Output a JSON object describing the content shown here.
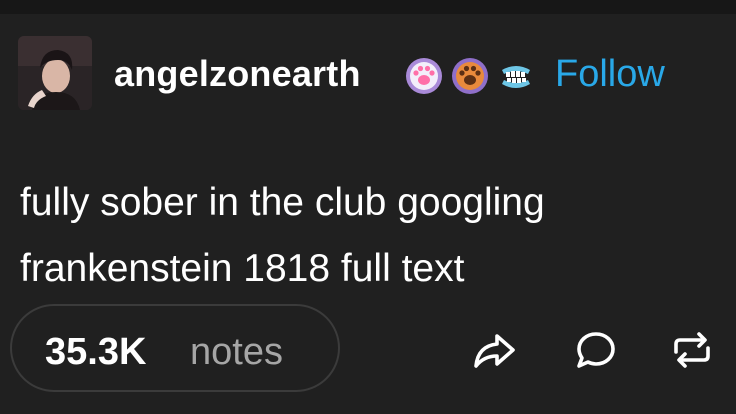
{
  "post": {
    "username": "angelzonearth",
    "follow_label": "Follow",
    "text_lines": [
      "fully sober in the club googling",
      "frankenstein 1818 full text"
    ],
    "notes_count": "35.3K",
    "notes_label": "notes"
  },
  "icons": {
    "avatar": "user-avatar",
    "badges": [
      "paw-badge-purple",
      "paw-badge-orange",
      "teeth-badge"
    ],
    "actions": [
      "share-icon",
      "reply-icon",
      "reblog-icon"
    ]
  },
  "colors": {
    "background": "#202020",
    "follow": "#29a8e8",
    "text": "#ffffff",
    "muted": "#a6a6a6"
  }
}
